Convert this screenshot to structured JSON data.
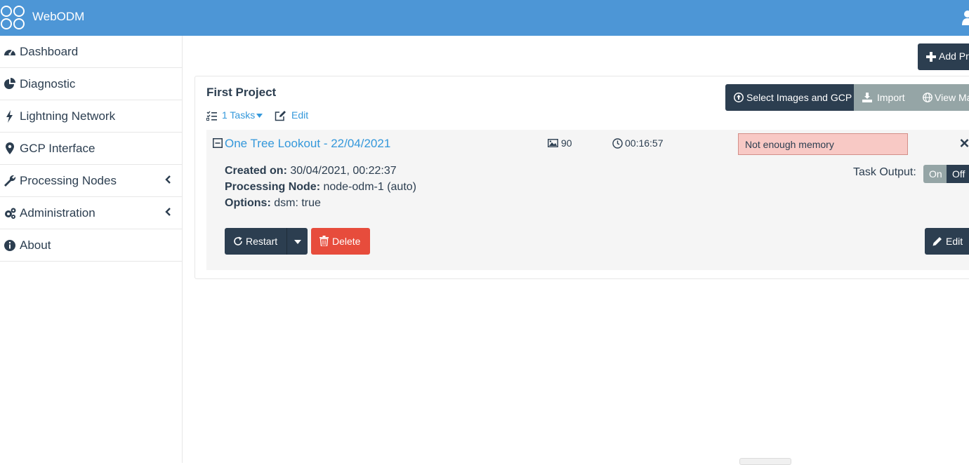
{
  "app": {
    "brand": "WebODM"
  },
  "sidebar": {
    "items": [
      {
        "label": "Dashboard",
        "icon": "dashboard-icon"
      },
      {
        "label": "Diagnostic",
        "icon": "pie-chart-icon"
      },
      {
        "label": "Lightning Network",
        "icon": "bolt-icon"
      },
      {
        "label": "GCP Interface",
        "icon": "map-marker-icon"
      },
      {
        "label": "Processing Nodes",
        "icon": "wrench-icon",
        "has_submenu": true
      },
      {
        "label": "Administration",
        "icon": "gears-icon",
        "has_submenu": true
      },
      {
        "label": "About",
        "icon": "info-circle-icon"
      }
    ]
  },
  "toolbar": {
    "add_project_label": "Add Pr"
  },
  "project": {
    "title": "First Project",
    "tasks_link": "1 Tasks",
    "edit_link": "Edit",
    "actions": {
      "select_images": "Select Images and GCP",
      "import": "Import",
      "view_map": "View Ma"
    },
    "task": {
      "name": "One Tree Lookout - 22/04/2021",
      "image_count": "90",
      "duration": "00:16:57",
      "status": "Not enough memory",
      "created_on_label": "Created on:",
      "created_on": "30/04/2021, 00:22:37",
      "processing_node_label": "Processing Node:",
      "processing_node": "node-odm-1 (auto)",
      "options_label": "Options:",
      "options": "dsm: true",
      "task_output_label": "Task Output:",
      "output_on": "On",
      "output_off": "Off",
      "output_state": "Off",
      "restart_label": "Restart",
      "delete_label": "Delete",
      "edit_label": "Edit"
    }
  },
  "colors": {
    "topbar": "#4d96d6",
    "primary_dark": "#2c3e50",
    "link": "#3498db",
    "danger": "#e74c3c",
    "muted": "#95a5a6",
    "status_error_bg": "#f8c9c5"
  }
}
